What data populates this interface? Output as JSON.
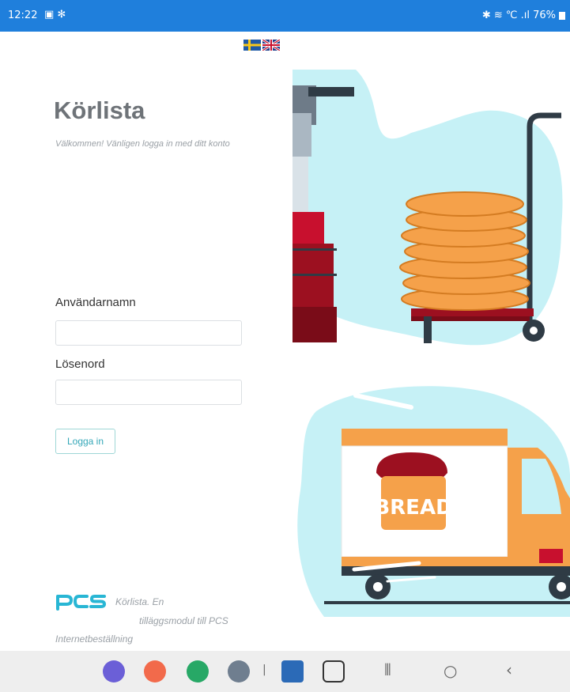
{
  "status_bar": {
    "time": "12:22",
    "left_icons": "▣ ✻",
    "right_text": "✱ ≋ ℃ .ıl 76%"
  },
  "login": {
    "title": "Körlista",
    "subtitle": "Välkommen! Vänligen logga in med ditt konto",
    "username_label": "Användarnamn",
    "username_value": "",
    "password_label": "Lösenord",
    "password_value": "",
    "login_button": "Logga in"
  },
  "footer": {
    "logo_text": "PCS",
    "line1": "Körlista. En",
    "line2": "tilläggsmodul till PCS",
    "line3": "Internetbeställning"
  },
  "illustration": {
    "truck_sign": "BREAD"
  },
  "colors": {
    "status_bar": "#1f7fdc",
    "accent_teal": "#34a7b8",
    "illustration_bg": "#c6f1f6",
    "bread_orange": "#f5a14a"
  }
}
